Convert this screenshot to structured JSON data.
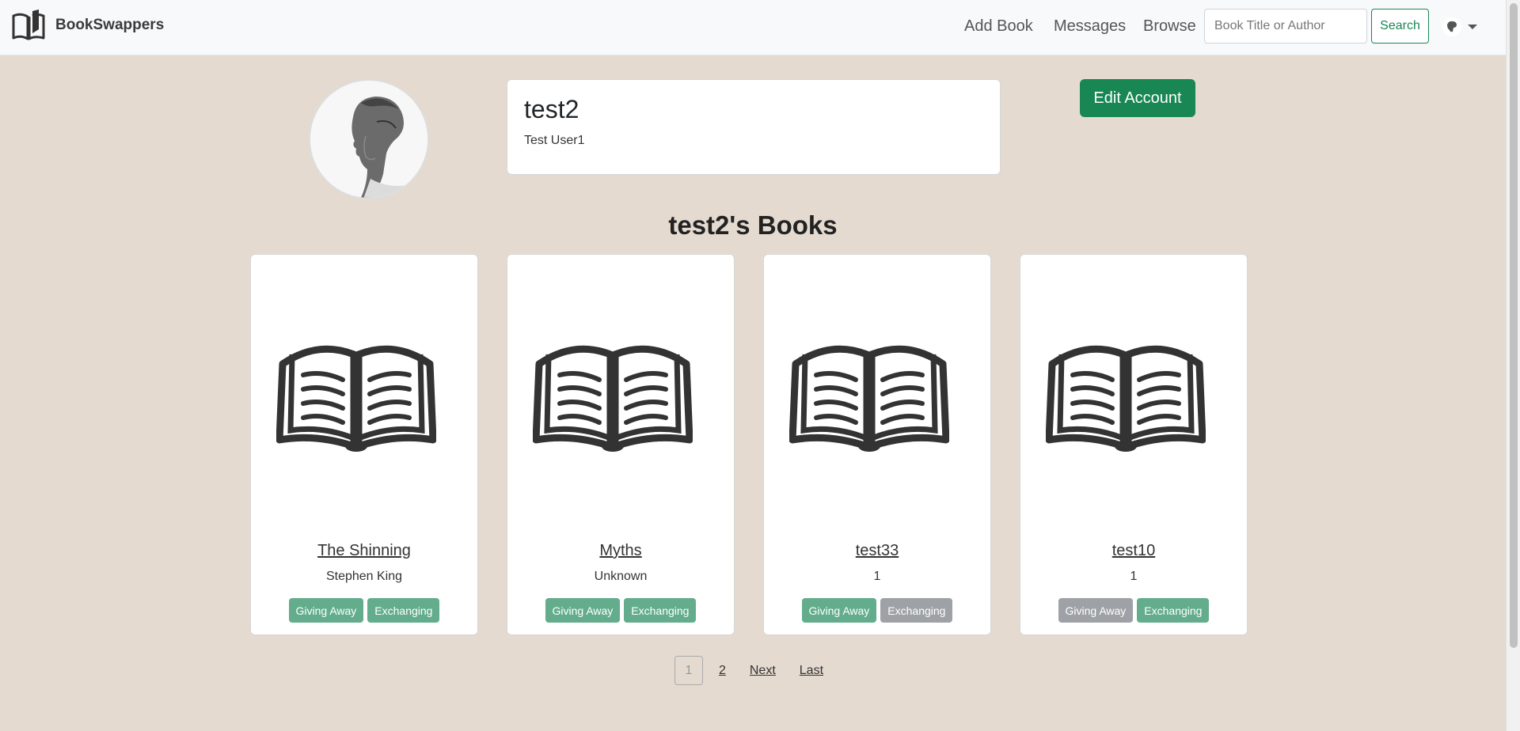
{
  "app": {
    "name": "BookSwappers"
  },
  "nav": {
    "links": [
      "Add Book",
      "Messages",
      "Browse"
    ],
    "search_placeholder": "Book Title or Author",
    "search_label": "Search"
  },
  "profile": {
    "username": "test2",
    "full_name": "Test User1",
    "edit_label": "Edit Account"
  },
  "books_heading": "test2's Books",
  "books": [
    {
      "title": "The Shinning",
      "author": "Stephen King",
      "giving_away": true,
      "exchanging": true
    },
    {
      "title": "Myths",
      "author": "Unknown",
      "giving_away": true,
      "exchanging": true
    },
    {
      "title": "test33",
      "author": "1",
      "giving_away": true,
      "exchanging": false
    },
    {
      "title": "test10",
      "author": "1",
      "giving_away": false,
      "exchanging": true
    }
  ],
  "badges": {
    "giving_away": "Giving Away",
    "exchanging": "Exchanging"
  },
  "colors": {
    "active_badge": "#63ad8d",
    "inactive_badge": "#9ea2a6",
    "accent": "#198754"
  },
  "pagination": {
    "pages": [
      "1",
      "2"
    ],
    "current": "1",
    "next": "Next",
    "last": "Last"
  },
  "icons": {
    "logo": "open-book-icon",
    "book_image": "open-book-icon",
    "user_menu": "user-avatar-icon"
  }
}
